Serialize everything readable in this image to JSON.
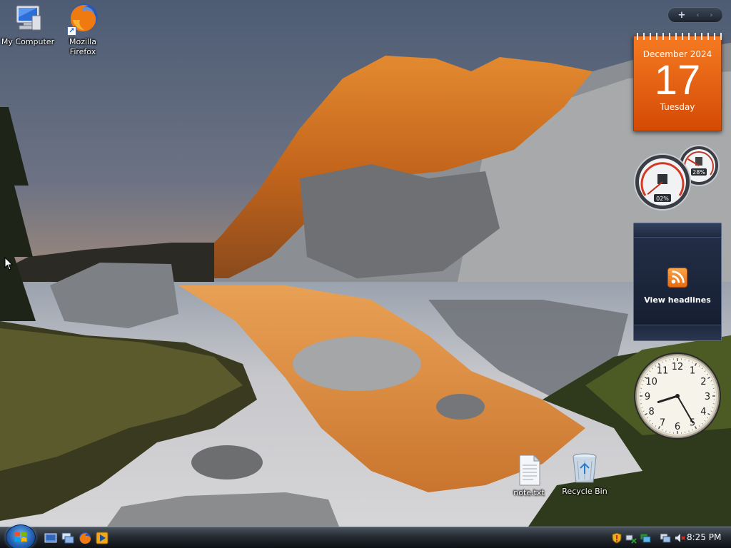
{
  "desktop": {
    "icons": [
      {
        "label": "My Computer",
        "icon": "computer-icon"
      },
      {
        "label": "Mozilla Firefox",
        "label_lines": [
          "Mozilla",
          "Firefox"
        ],
        "icon": "firefox-icon",
        "shortcut": true
      },
      {
        "label": "note.txt",
        "icon": "text-file-icon"
      },
      {
        "label": "Recycle Bin",
        "icon": "recycle-bin-icon"
      }
    ]
  },
  "sidebar": {
    "controls": {
      "add": "+",
      "prev": "‹",
      "next": "›"
    },
    "calendar": {
      "month_year": "December 2024",
      "day": "17",
      "weekday": "Tuesday"
    },
    "cpu_meter": {
      "cpu_percent": "02%",
      "memory_percent": "28%",
      "cpu_value": 0.02,
      "memory_value": 0.28
    },
    "feed": {
      "label": "View headlines",
      "icon": "rss-icon"
    },
    "clock": {
      "hour": 8,
      "minute": 25,
      "numerals": [
        "12",
        "1",
        "2",
        "3",
        "4",
        "5",
        "6",
        "7",
        "8",
        "9",
        "10",
        "11"
      ]
    }
  },
  "taskbar": {
    "start_icon": "windows-logo-icon",
    "quick_launch": [
      "show-desktop-icon",
      "switch-windows-icon",
      "firefox-icon",
      "media-player-icon"
    ],
    "tray_icons": [
      "security-shield-icon",
      "network-icon",
      "network-activity-icon",
      "network-connection-icon",
      "volume-muted-icon"
    ],
    "time": "8:25 PM"
  },
  "colors": {
    "calendar_orange": "#e85f10",
    "taskbar": "#262b33",
    "feed_panel": "#1c2538"
  }
}
